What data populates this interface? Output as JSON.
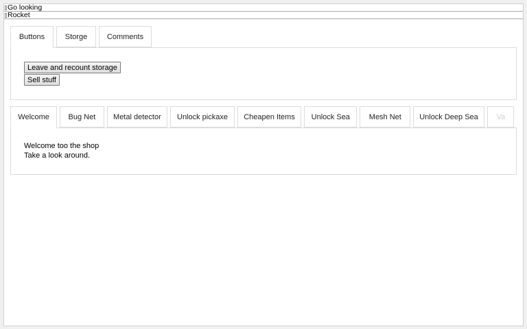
{
  "top_bars": [
    {
      "label": "Go looking"
    },
    {
      "label": "Rocket"
    }
  ],
  "upper_tabs": [
    {
      "label": "Buttons",
      "active": true
    },
    {
      "label": "Storge",
      "active": false
    },
    {
      "label": "Comments",
      "active": false
    }
  ],
  "buttons_panel": {
    "leave_label": "Leave and recount storage",
    "sell_label": "Sell stuff"
  },
  "lower_tabs": [
    {
      "label": "Welcome",
      "active": true
    },
    {
      "label": "Bug Net"
    },
    {
      "label": "Metal detector"
    },
    {
      "label": "Unlock pickaxe"
    },
    {
      "label": "Cheapen Items"
    },
    {
      "label": "Unlock Sea"
    },
    {
      "label": "Mesh Net"
    },
    {
      "label": "Unlock Deep Sea"
    },
    {
      "label": "Va"
    }
  ],
  "welcome_panel": {
    "line1": "Welcome too the shop",
    "line2": "Take a look around."
  }
}
